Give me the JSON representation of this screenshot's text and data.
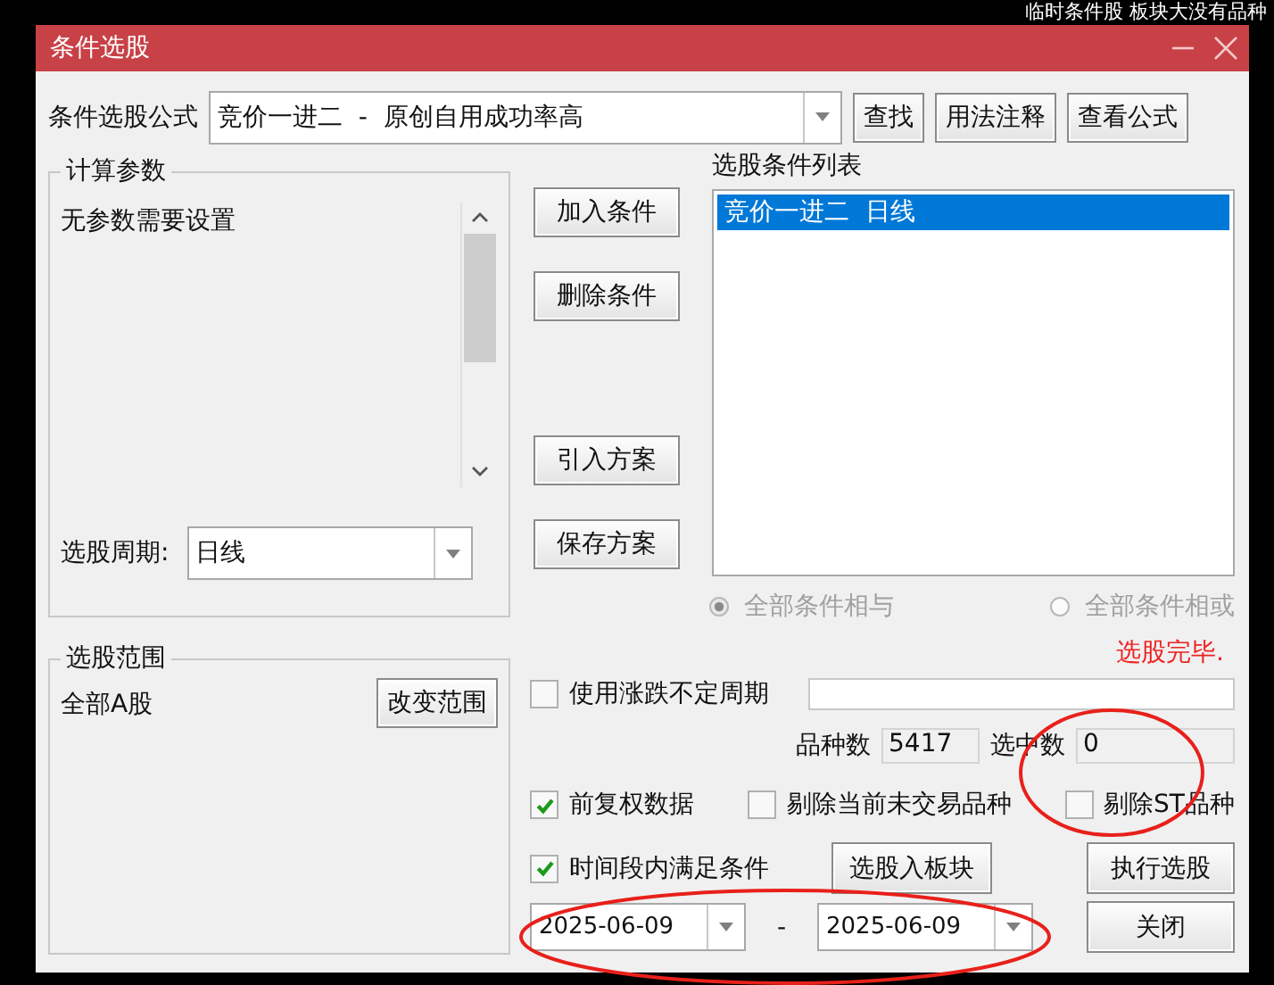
{
  "background_text": "临时条件股 板块大没有品种",
  "window": {
    "title": "条件选股"
  },
  "formula": {
    "label": "条件选股公式",
    "value": "竞价一进二  -  原创自用成功率高"
  },
  "top_buttons": [
    "查找",
    "用法注释",
    "查看公式"
  ],
  "params": {
    "title": "计算参数",
    "message": "无参数需要设置",
    "period_label": "选股周期:",
    "period_value": "日线"
  },
  "scope": {
    "title": "选股范围",
    "value": "全部A股",
    "button": "改变范围"
  },
  "side_buttons": [
    "加入条件",
    "删除条件",
    "引入方案",
    "保存方案"
  ],
  "condition_list": {
    "title": "选股条件列表",
    "items": [
      {
        "label": "竞价一进二  日线",
        "selected": true
      }
    ]
  },
  "logic_radios": [
    {
      "label": "全部条件相与",
      "selected": true,
      "disabled": true
    },
    {
      "label": "全部条件相或",
      "selected": false,
      "disabled": true
    }
  ],
  "status": "选股完毕.",
  "variable_period": {
    "label": "使用涨跌不定周期",
    "checked": false
  },
  "counts": [
    {
      "label": "品种数",
      "value": "5417"
    },
    {
      "label": "选中数",
      "value": "0"
    }
  ],
  "options": [
    {
      "label": "前复权数据",
      "checked": true
    },
    {
      "label": "剔除当前未交易品种",
      "checked": false
    },
    {
      "label": "剔除ST品种",
      "checked": false
    }
  ],
  "period_filter": {
    "label": "时间段内满足条件",
    "checked": true
  },
  "dates": {
    "start": "2025-06-09",
    "separator": "-",
    "end": "2025-06-09"
  },
  "action_buttons": [
    "选股入板块",
    "执行选股",
    "关闭"
  ]
}
